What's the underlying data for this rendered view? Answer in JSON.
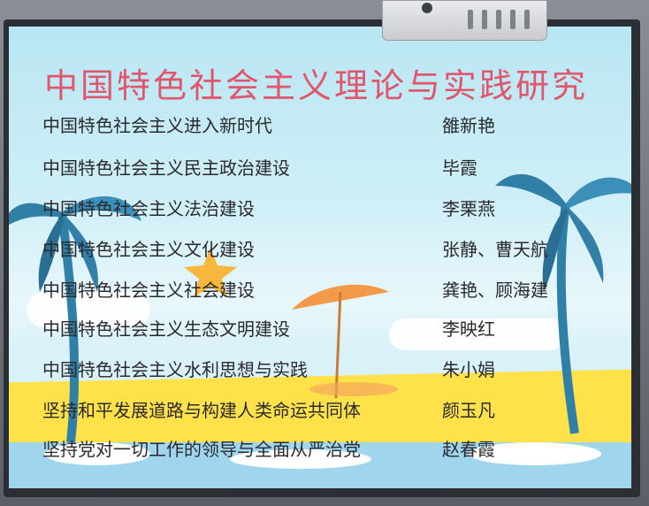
{
  "slide": {
    "title": "中国特色社会主义理论与实践研究",
    "items": [
      {
        "topic": "中国特色社会主义进入新时代",
        "author": "雒新艳"
      },
      {
        "topic": "中国特色社会主义民主政治建设",
        "author": "毕霞"
      },
      {
        "topic": "中国特色社会主义法治建设",
        "author": "李栗燕"
      },
      {
        "topic": "中国特色社会主义文化建设",
        "author": "张静、曹天航"
      },
      {
        "topic": "中国特色社会主义社会建设",
        "author": "龚艳、顾海建"
      },
      {
        "topic": "中国特色社会主义生态文明建设",
        "author": "李映红"
      },
      {
        "topic": "中国特色社会主义水利思想与实践",
        "author": "朱小娟"
      },
      {
        "topic": "坚持和平发展道路与构建人类命运共同体",
        "author": "颜玉凡"
      },
      {
        "topic": "坚持党对一切工作的领导与全面从严治党",
        "author": "赵春霞"
      }
    ]
  },
  "colors": {
    "title": "#e0566c",
    "text": "#2a2a2e",
    "sand": "#ffe24a",
    "sky": "#b9e6f3",
    "umbrella": "#f29a4a",
    "palm": "#2f7fa6",
    "starfish": "#f6b73c"
  },
  "icons": [
    "palm-tree-icon",
    "umbrella-icon",
    "starfish-icon",
    "projector-icon"
  ]
}
